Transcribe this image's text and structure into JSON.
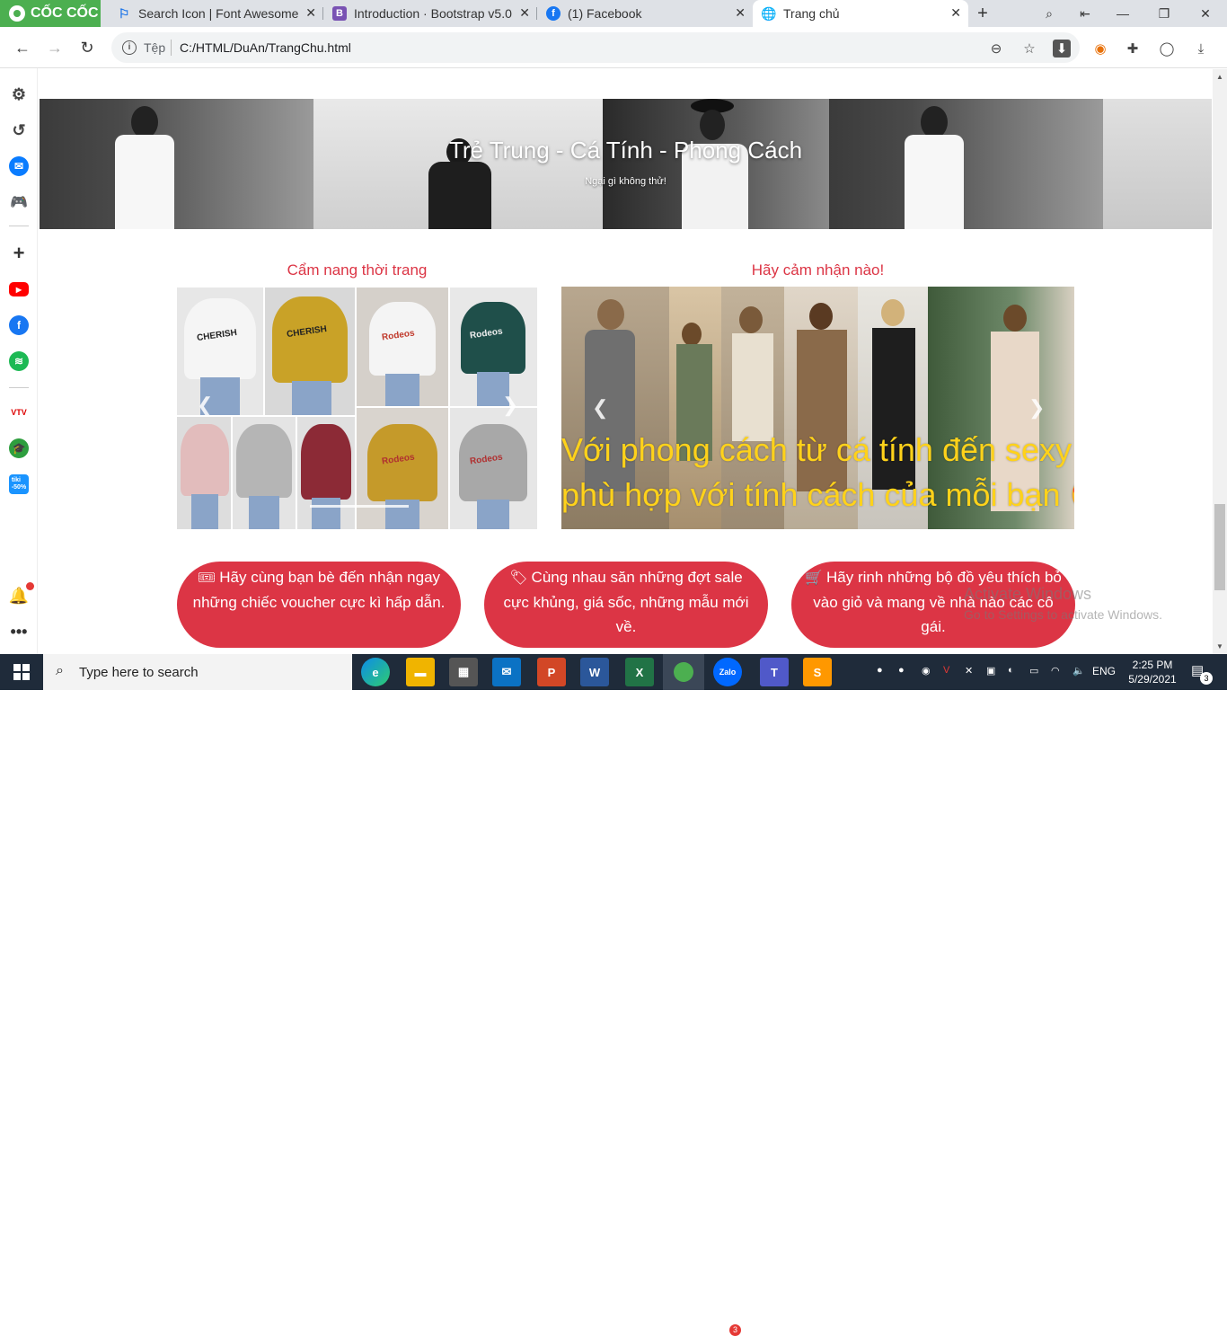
{
  "browser": {
    "brand": "CỐC CỐC",
    "tabs": [
      {
        "title": "Search Icon | Font Awesome",
        "icon": "flag-icon"
      },
      {
        "title": "Introduction · Bootstrap v5.0",
        "icon": "bootstrap-icon"
      },
      {
        "title": "(1) Facebook",
        "icon": "facebook-icon"
      },
      {
        "title": "Trang chủ",
        "icon": "globe-icon"
      }
    ],
    "new_tab": "+",
    "address": {
      "security_label": "Tệp",
      "url": "C:/HTML/DuAn/TrangChu.html"
    }
  },
  "page": {
    "banner": {
      "title": "Trẻ Trung - Cá Tính - Phong Cách",
      "subtitle": "Ngại gì không thử!"
    },
    "section_left": {
      "title": "Cẩm nang thời trang",
      "shirt_text": "CHERISH",
      "shirt_text2": "Rodeos"
    },
    "section_right": {
      "title": "Hãy cảm nhận nào!",
      "overlay_line1": "Với phong cách từ cá tính đến sexy",
      "overlay_line2": "phù hợp với tính cách của mỗi bạn 😍"
    },
    "pills": [
      {
        "icon": "ticket-icon",
        "text": "Hãy cùng bạn bè đến nhận ngay những chiếc voucher cực kì hấp dẫn."
      },
      {
        "icon": "tags-icon",
        "text": "Cùng nhau săn những đợt sale cực khủng, giá sốc, những mẫu mới về."
      },
      {
        "icon": "cart-icon",
        "text": "Hãy rinh những bộ đồ yêu thích bỏ vào giỏ và mang về nhà nào các cô gái."
      }
    ],
    "watermark": {
      "line1": "Activate Windows",
      "line2": "Go to Settings to activate Windows."
    }
  },
  "taskbar": {
    "search_placeholder": "Type here to search",
    "language": "ENG",
    "time": "2:25 PM",
    "date": "5/29/2021",
    "notification_count": "3",
    "zalo_badge": "3"
  },
  "colors": {
    "accent": "#dc3545",
    "overlay_text": "#ffd21a",
    "taskbar": "#1f2b3a",
    "coccoc": "#4caf50"
  }
}
